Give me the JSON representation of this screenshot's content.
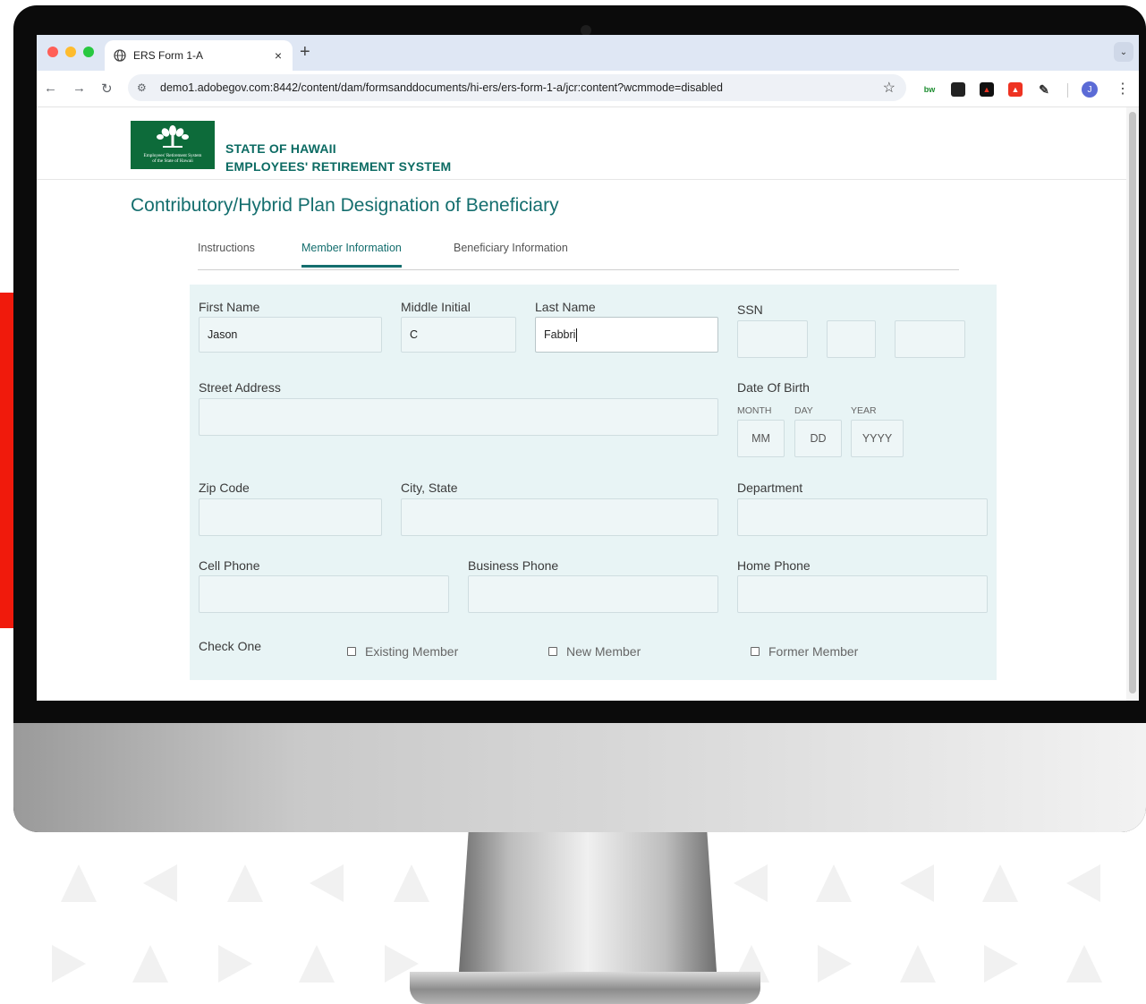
{
  "browser": {
    "tab_title": "ERS Form 1-A",
    "tab_close": "×",
    "new_tab": "+",
    "url": "demo1.adobegov.com:8442/content/dam/formsanddocuments/hi-ers/ers-form-1-a/jcr:content?wcmmode=disabled",
    "profile_initial": "J",
    "ext_bw_label": "bw"
  },
  "header": {
    "logo_text_line1": "Employees' Retirement System",
    "logo_text_line2": "of the State of Hawaii",
    "org_line1": "STATE OF HAWAII",
    "org_line2": "EMPLOYEES' RETIREMENT SYSTEM"
  },
  "form": {
    "title": "Contributory/Hybrid Plan Designation of Beneficiary",
    "tabs": [
      "Instructions",
      "Member Information",
      "Beneficiary Information"
    ],
    "active_tab": "Member Information"
  },
  "fields": {
    "first_name": {
      "label": "First Name",
      "value": "Jason"
    },
    "middle_initial": {
      "label": "Middle Initial",
      "value": "C"
    },
    "last_name": {
      "label": "Last Name",
      "value": "Fabbri"
    },
    "ssn": {
      "label": "SSN"
    },
    "street_address": {
      "label": "Street Address",
      "value": ""
    },
    "dob": {
      "label": "Date Of Birth",
      "month_label": "MONTH",
      "day_label": "DAY",
      "year_label": "YEAR",
      "month_placeholder": "MM",
      "day_placeholder": "DD",
      "year_placeholder": "YYYY"
    },
    "zip_code": {
      "label": "Zip Code",
      "value": ""
    },
    "city_state": {
      "label": "City, State",
      "value": ""
    },
    "department": {
      "label": "Department",
      "value": ""
    },
    "cell_phone": {
      "label": "Cell Phone",
      "value": ""
    },
    "business_phone": {
      "label": "Business Phone",
      "value": ""
    },
    "home_phone": {
      "label": "Home Phone",
      "value": ""
    }
  },
  "check_one": {
    "label": "Check One",
    "options": [
      "Existing Member",
      "New Member",
      "Former Member"
    ]
  },
  "colors": {
    "accent": "#146e6e",
    "panel_bg": "#e8f4f5",
    "logo_green": "#0d6b3a",
    "brand_red": "#f01a0c"
  }
}
